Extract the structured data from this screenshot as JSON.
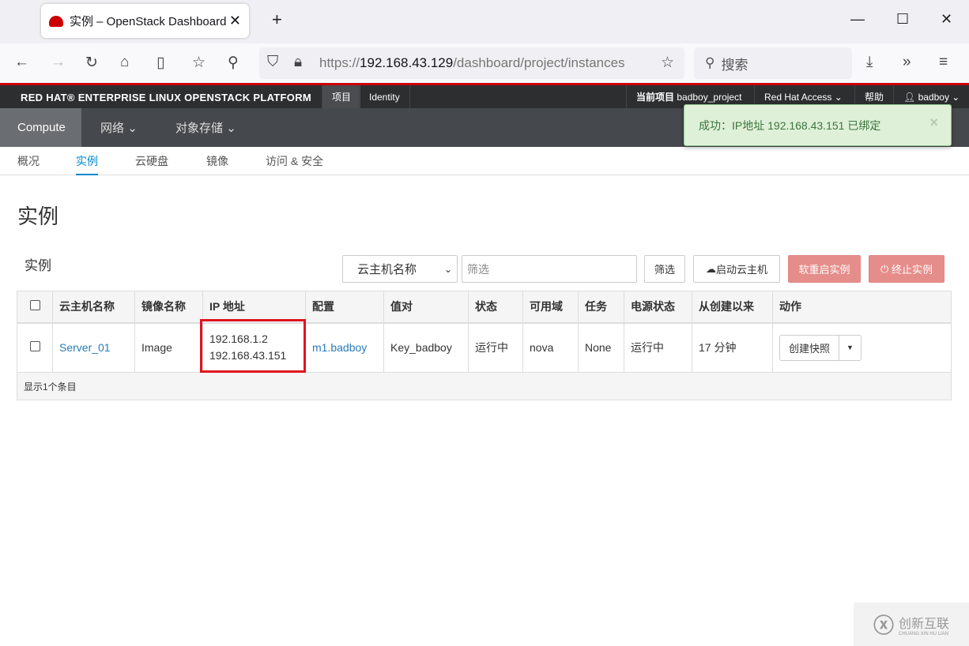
{
  "browser": {
    "tab_title": "实例 – OpenStack Dashboard",
    "url_prefix": "https://",
    "url_host": "192.168.43.129",
    "url_path": "/dashboard/project/instances",
    "search_placeholder": "搜索"
  },
  "masthead": {
    "brand": "RED HAT® ENTERPRISE LINUX OPENSTACK PLATFORM",
    "tabs": [
      "项目",
      "Identity"
    ],
    "current_project_label": "当前项目",
    "current_project": "badboy_project",
    "redhat_access": "Red Hat Access",
    "help": "帮助",
    "user": "badboy"
  },
  "nav": {
    "items": [
      "Compute",
      "网络",
      "对象存储"
    ]
  },
  "subnav": {
    "items": [
      "概况",
      "实例",
      "云硬盘",
      "镜像",
      "访问 & 安全"
    ]
  },
  "alert": {
    "text": "成功：IP地址 192.168.43.151 已绑定",
    "close": "×"
  },
  "page_title": "实例",
  "section_title": "实例",
  "controls": {
    "filter_select": "云主机名称",
    "filter_placeholder": "筛选",
    "filter_btn": "筛选",
    "launch": "启动云主机",
    "soft_reboot": "软重启实例",
    "terminate": "终止实例"
  },
  "table": {
    "headers": [
      "云主机名称",
      "镜像名称",
      "IP 地址",
      "配置",
      "值对",
      "状态",
      "可用域",
      "任务",
      "电源状态",
      "从创建以来",
      "动作"
    ],
    "rows": [
      {
        "name": "Server_01",
        "image": "Image",
        "ips": [
          "192.168.1.2",
          "192.168.43.151"
        ],
        "flavor": "m1.badboy",
        "keypair": "Key_badboy",
        "status": "运行中",
        "zone": "nova",
        "task": "None",
        "power": "运行中",
        "age": "17 分钟",
        "action": "创建快照"
      }
    ],
    "footer": "显示1个条目"
  },
  "watermark": {
    "text": "创新互联",
    "sub": "CHUANG XIN HU LIAN"
  }
}
